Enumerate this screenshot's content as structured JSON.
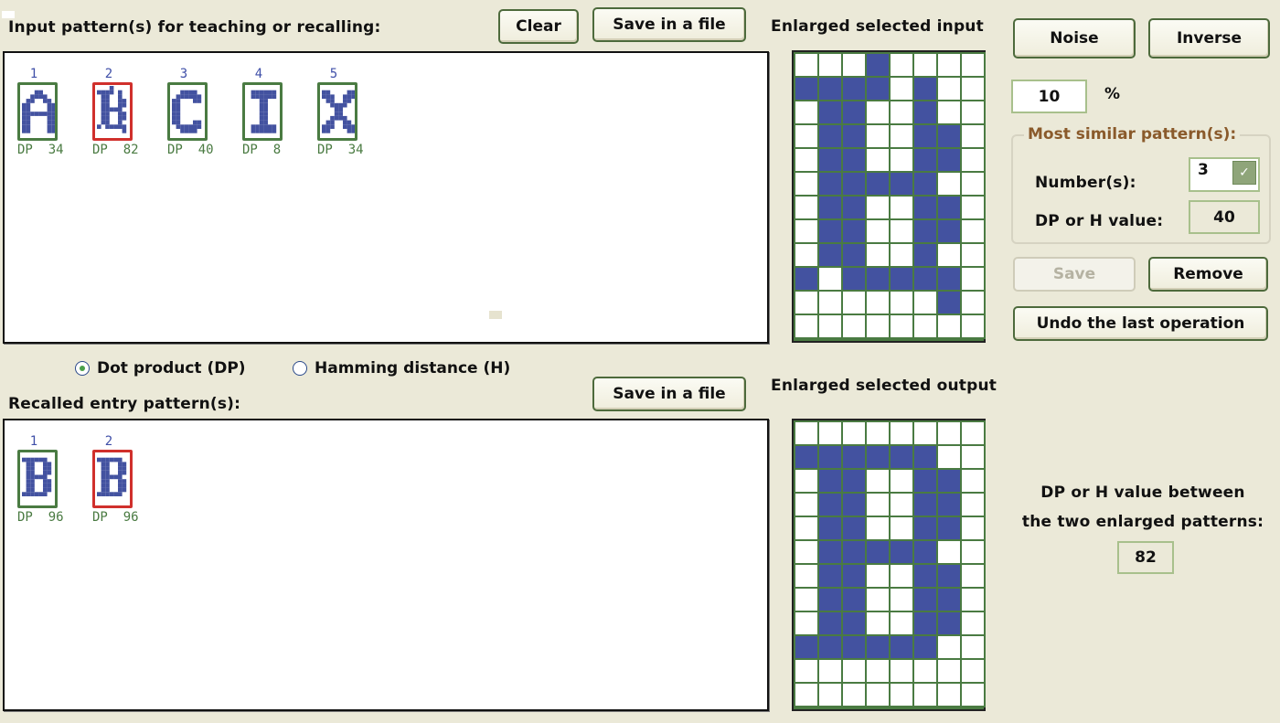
{
  "input_section": {
    "title": "Input pattern(s) for teaching or recalling:",
    "clear_label": "Clear",
    "save_label": "Save in a file",
    "patterns": [
      {
        "index": "1",
        "letter": "A",
        "score": "DP  34",
        "selected": false,
        "bitmap": [
          "00000000",
          "00011000",
          "00111100",
          "01100110",
          "11000011",
          "11000011",
          "11111111",
          "11000011",
          "11000011",
          "11000011",
          "11000011",
          "00000000"
        ]
      },
      {
        "index": "2",
        "letter": "B (noisy)",
        "score": "DP  82",
        "selected": true,
        "bitmap": [
          "00010000",
          "11110100",
          "01100100",
          "01100110",
          "01100110",
          "01111100",
          "01100110",
          "01100110",
          "01100100",
          "10111110",
          "00000010",
          "00000000"
        ]
      },
      {
        "index": "3",
        "letter": "C",
        "score": "DP  40",
        "selected": false,
        "bitmap": [
          "00000000",
          "00111100",
          "01111110",
          "11000110",
          "11000000",
          "11000000",
          "11000000",
          "11000000",
          "11000110",
          "01111110",
          "00111100",
          "00000000"
        ]
      },
      {
        "index": "4",
        "letter": "I",
        "score": "DP  8",
        "selected": false,
        "bitmap": [
          "00000000",
          "01111110",
          "01111110",
          "00011000",
          "00011000",
          "00011000",
          "00011000",
          "00011000",
          "00011000",
          "01111110",
          "01111110",
          "00000000"
        ]
      },
      {
        "index": "5",
        "letter": "X",
        "score": "DP  34",
        "selected": false,
        "bitmap": [
          "00000000",
          "11000011",
          "11100111",
          "01100110",
          "00111100",
          "00011000",
          "00011000",
          "00111100",
          "01100110",
          "11100111",
          "11000011",
          "00000000"
        ]
      }
    ]
  },
  "similarity": {
    "dot_product_label": "Dot product (DP)",
    "hamming_label": "Hamming distance (H)",
    "selected": "dot_product"
  },
  "recalled_section": {
    "title": "Recalled entry pattern(s):",
    "save_label": "Save in a file",
    "patterns": [
      {
        "index": "1",
        "letter": "B",
        "score": "DP  96",
        "selected": false,
        "bitmap": [
          "00000000",
          "11111100",
          "01100110",
          "01100110",
          "01100110",
          "01111100",
          "01100110",
          "01100110",
          "01100110",
          "11111100",
          "00000000",
          "00000000"
        ]
      },
      {
        "index": "2",
        "letter": "B",
        "score": "DP  96",
        "selected": true,
        "bitmap": [
          "00000000",
          "11111100",
          "01100110",
          "01100110",
          "01100110",
          "01111100",
          "01100110",
          "01100110",
          "01100110",
          "11111100",
          "00000000",
          "00000000"
        ]
      }
    ]
  },
  "enlarged_input": {
    "title": "Enlarged selected input",
    "bitmap": [
      "00010000",
      "11110100",
      "01100100",
      "01100110",
      "01100110",
      "01111100",
      "01100110",
      "01100110",
      "01100100",
      "10111110",
      "00000010",
      "00000000"
    ]
  },
  "enlarged_output": {
    "title": "Enlarged selected output",
    "bitmap": [
      "00000000",
      "11111100",
      "01100110",
      "01100110",
      "01100110",
      "01111100",
      "01100110",
      "01100110",
      "01100110",
      "11111100",
      "00000000",
      "00000000"
    ]
  },
  "controls": {
    "noise_label": "Noise",
    "inverse_label": "Inverse",
    "noise_percent_value": "10",
    "percent_sign": "%",
    "most_similar_title": "Most similar pattern(s):",
    "numbers_label": "Number(s):",
    "numbers_value": "3",
    "dp_h_label": "DP or H value:",
    "dp_h_value": "40",
    "save_label": "Save",
    "remove_label": "Remove",
    "undo_label": "Undo the last operation"
  },
  "comparison": {
    "line1": "DP or H value between",
    "line2": "the two enlarged patterns:",
    "value": "82"
  },
  "colors": {
    "pixel_on": "#4352a0",
    "pixel_off": "#ffffff",
    "grid_line": "#4a7b42",
    "selected_frame": "#d0302c",
    "normal_frame": "#4a7b42"
  }
}
